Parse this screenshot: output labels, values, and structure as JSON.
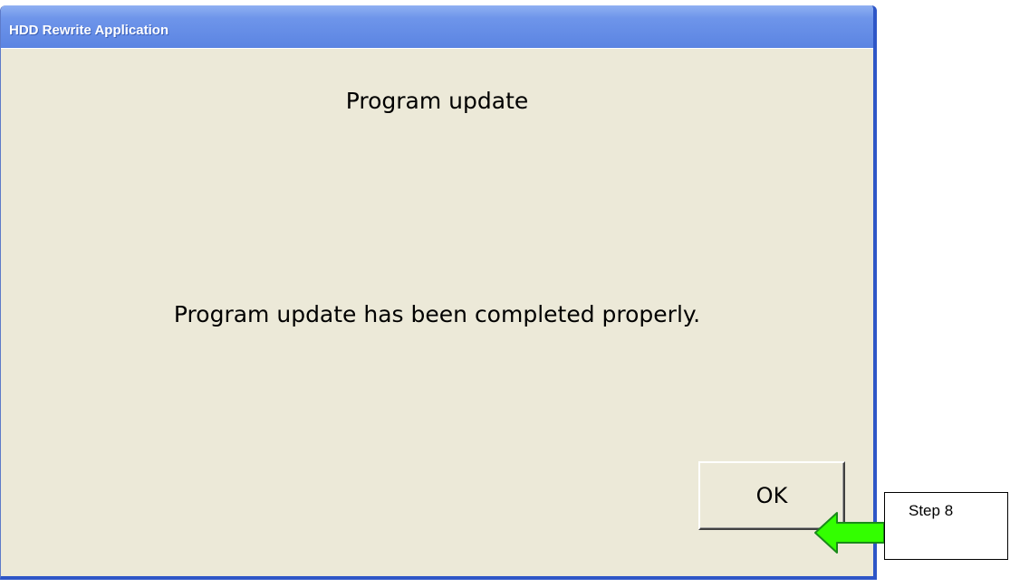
{
  "window": {
    "title": "HDD Rewrite Application"
  },
  "dialog": {
    "heading": "Program update",
    "message": "Program update has been completed properly.",
    "ok_label": "OK"
  },
  "annotation": {
    "callout_text": "Step 8",
    "arrow_color": "#33ff00"
  },
  "colors": {
    "titlebar": "#6e95ea",
    "window_bg": "#ece9d8",
    "window_frame": "#2e56c7"
  }
}
